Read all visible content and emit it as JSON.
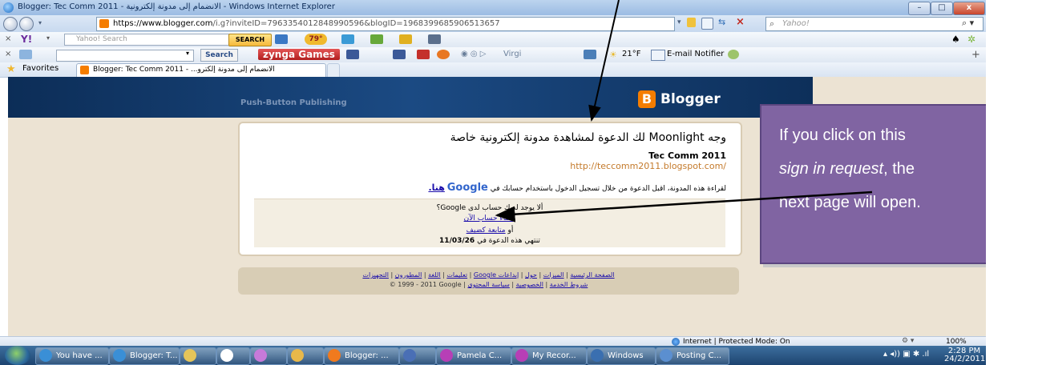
{
  "window": {
    "title": "Blogger: Tec Comm 2011 - الانضمام إلى مدونة إلكترونية - Windows Internet Explorer",
    "minimize": "–",
    "maximize": "□",
    "close": "x"
  },
  "address_bar": {
    "url_host": "https://www.blogger.com",
    "url_path": "/i.g?inviteID=7963354012848990596&blogID=1968399685906513657",
    "search_placeholder": "Yahoo!"
  },
  "yahoo_toolbar": {
    "search_placeholder": "Yahoo! Search",
    "search_button": "SEARCH",
    "weather": "79°"
  },
  "zynga_toolbar": {
    "search_button": "Search",
    "zynga_label": "zynga Games",
    "virgil": "Virgi",
    "temperature": "21°F",
    "email_notifier": "E-mail Notifier"
  },
  "favorites_bar": {
    "favorites_label": "Favorites",
    "tab_title": "Blogger: Tec Comm 2011 - ...الانضمام إلى مدونة إلكترو"
  },
  "page": {
    "tagline": "Push-Button Publishing",
    "logo_text": "Blogger",
    "invite_text": "وجه Moonlight لك الدعوة لمشاهدة مدونة إلكترونية خاصة",
    "blog_name": "Tec Comm 2011",
    "blog_url": "http://teccomm2011.blogspot.com/",
    "signin_prompt": "لقراءة هذه المدونة، اقبل الدعوة من خلال تسجيل الدخول باستخدام حسابك في",
    "google_logo": "Google",
    "signin_link": "هنا.",
    "no_account": "ألا يوجد لديك حساب لدى Google؟",
    "create_account": "إنشاء حساب الآن",
    "or_label": "أو",
    "continue_guest": "متابعة كضيف",
    "expires_prefix": "تنتهي هذه الدعوة في",
    "expires_date": "11/03/26"
  },
  "footer": {
    "links": [
      "الصفحة الرئيسية",
      "الميزات",
      "حول",
      "إبداعات Google",
      "تعليمات",
      "اللغة",
      "المطورون",
      "التجهيزات"
    ],
    "copyright": "© 1999 - 2011 Google",
    "links2": [
      "شروط الخدمة",
      "الخصوصية",
      "سياسة المحتوى"
    ]
  },
  "callout": {
    "line1": "If you click on this",
    "line2": "sign in request",
    "line2_suffix": ", the",
    "line3": "next page will open."
  },
  "status_bar": {
    "zone": "Internet | Protected Mode: On",
    "zoom": "100%"
  },
  "taskbar": {
    "items": [
      {
        "label": "You have ...",
        "color": "#3a8fd6"
      },
      {
        "label": "Blogger: T...",
        "color": "#3a8fd6"
      },
      {
        "label": "",
        "color": "#e5c55a"
      },
      {
        "label": "",
        "color": "#ffffff"
      },
      {
        "label": "",
        "color": "#c77ad9"
      },
      {
        "label": "",
        "color": "#e8b84a"
      },
      {
        "label": "Blogger: ...",
        "color": "#f07a1e"
      },
      {
        "label": "",
        "color": "#4a6fb5"
      },
      {
        "label": "Pamela C...",
        "color": "#b73fb6"
      },
      {
        "label": "My Recor...",
        "color": "#b73fb6"
      },
      {
        "label": "Windows",
        "color": "#3a6fb0"
      },
      {
        "label": "Posting C...",
        "color": "#5b8fd0"
      }
    ],
    "time": "2:28 PM",
    "date": "24/2/2011"
  }
}
